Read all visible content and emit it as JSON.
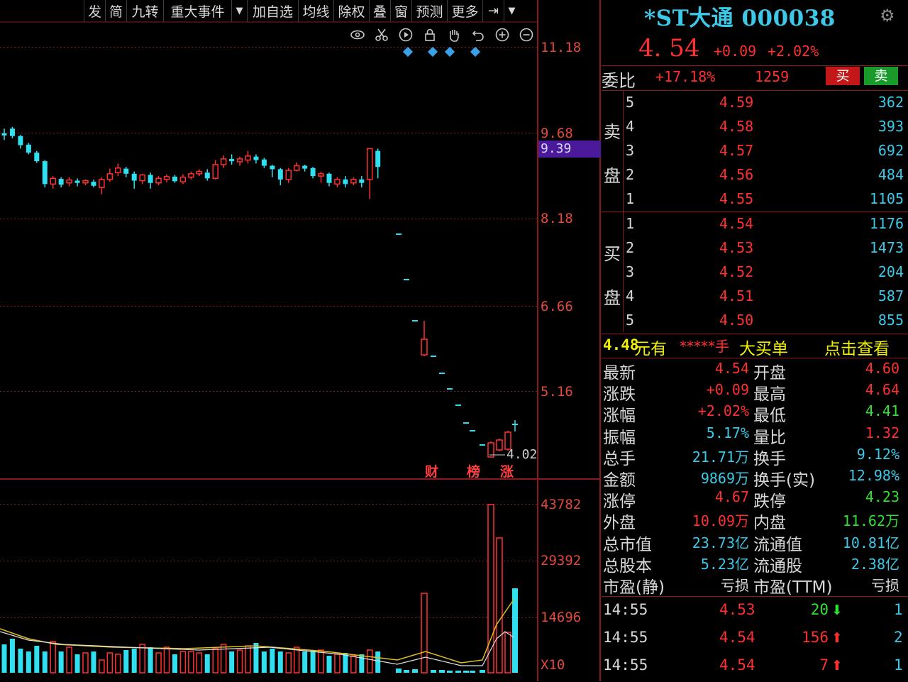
{
  "toolbar": {
    "items": [
      "发",
      "简",
      "九转",
      "重大事件",
      "加自选",
      "均线",
      "除权",
      "叠",
      "窗",
      "预测",
      "更多"
    ]
  },
  "chart": {
    "price_axis": [
      "11.18",
      "9.68",
      "8.18",
      "6.66",
      "5.16"
    ],
    "current_marker": "9.39",
    "low_label": "4.02",
    "events": [
      "财",
      "榜",
      "涨"
    ],
    "volume_axis": [
      "43782",
      "29392",
      "14696",
      "X10"
    ]
  },
  "quote": {
    "name": "*ST大通 000038",
    "last_price": "4. 54",
    "change_abs": "+0.09",
    "change_pct": "+2.02%"
  },
  "weibi": {
    "label": "委比",
    "pct": "+17.18%",
    "diff": "1259",
    "buy": "买",
    "sell": "卖"
  },
  "order_book": {
    "sell_label_top": "卖",
    "sell_label_bottom": "盘",
    "buy_label_top": "买",
    "buy_label_bottom": "盘",
    "asks": [
      {
        "level": "5",
        "price": "4.59",
        "vol": "362"
      },
      {
        "level": "4",
        "price": "4.58",
        "vol": "393"
      },
      {
        "level": "3",
        "price": "4.57",
        "vol": "692"
      },
      {
        "level": "2",
        "price": "4.56",
        "vol": "484"
      },
      {
        "level": "1",
        "price": "4.55",
        "vol": "1105"
      }
    ],
    "bids": [
      {
        "level": "1",
        "price": "4.54",
        "vol": "1176"
      },
      {
        "level": "2",
        "price": "4.53",
        "vol": "1473"
      },
      {
        "level": "3",
        "price": "4.52",
        "vol": "204"
      },
      {
        "level": "4",
        "price": "4.51",
        "vol": "587"
      },
      {
        "level": "5",
        "price": "4.50",
        "vol": "855"
      }
    ]
  },
  "big_order": {
    "price": "4.48",
    "text1": "元有",
    "stars": "*****手",
    "text2": "大买单",
    "link": "点击查看"
  },
  "stats": [
    {
      "l1": "最新",
      "v1": "4.54",
      "c1": "red",
      "l2": "开盘",
      "v2": "4.60",
      "c2": "red"
    },
    {
      "l1": "涨跌",
      "v1": "+0.09",
      "c1": "red",
      "l2": "最高",
      "v2": "4.64",
      "c2": "red"
    },
    {
      "l1": "涨幅",
      "v1": "+2.02%",
      "c1": "red",
      "l2": "最低",
      "v2": "4.41",
      "c2": "green"
    },
    {
      "l1": "振幅",
      "v1": "5.17%",
      "c1": "cyan",
      "l2": "量比",
      "v2": "1.32",
      "c2": "red"
    },
    {
      "l1": "总手",
      "v1": "21.71万",
      "c1": "cyan",
      "l2": "换手",
      "v2": "9.12%",
      "c2": "cyan"
    },
    {
      "l1": "金额",
      "v1": "9869万",
      "c1": "cyan",
      "l2": "换手(实)",
      "v2": "12.98%",
      "c2": "cyan"
    },
    {
      "l1": "涨停",
      "v1": "4.67",
      "c1": "red",
      "l2": "跌停",
      "v2": "4.23",
      "c2": "green"
    },
    {
      "l1": "外盘",
      "v1": "10.09万",
      "c1": "red",
      "l2": "内盘",
      "v2": "11.62万",
      "c2": "green"
    },
    {
      "l1": "总市值",
      "v1": "23.73亿",
      "c1": "cyan",
      "l2": "流通值",
      "v2": "10.81亿",
      "c2": "cyan"
    },
    {
      "l1": "总股本",
      "v1": "5.23亿",
      "c1": "cyan",
      "l2": "流通股",
      "v2": "2.38亿",
      "c2": "cyan"
    },
    {
      "l1": "市盈(静)",
      "v1": "亏损",
      "c1": "white",
      "l2": "市盈(TTM)",
      "v2": "亏损",
      "c2": "white"
    }
  ],
  "ticks": [
    {
      "time": "14:55",
      "price": "4.53",
      "vol": "20",
      "dir": "down",
      "cnt": "1"
    },
    {
      "time": "14:55",
      "price": "4.54",
      "vol": "156",
      "dir": "up",
      "cnt": "2"
    },
    {
      "time": "14:55",
      "price": "4.54",
      "vol": "7",
      "dir": "up",
      "cnt": "1"
    }
  ],
  "colors": {
    "up": "#ff3030",
    "down": "#30e0f0",
    "grid": "#8a1a1a",
    "ma_white": "#e0e0e0",
    "ma_yellow": "#e0c020"
  }
}
